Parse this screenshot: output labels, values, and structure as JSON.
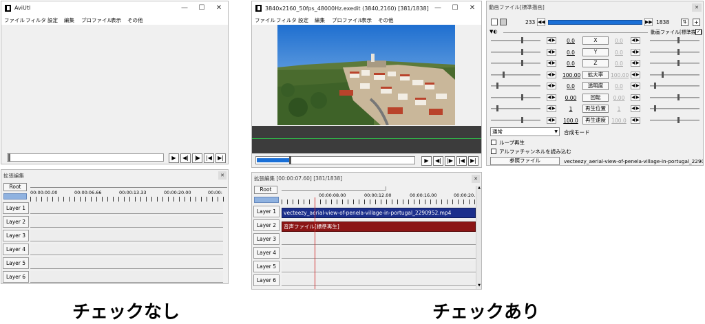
{
  "left_main": {
    "title": "AviUtl",
    "menu": [
      "ファイル",
      "フィルタ",
      "設定",
      "編集",
      "プロファイル",
      "表示",
      "その他"
    ]
  },
  "left_timeline": {
    "title": "拡張編集",
    "root": "Root",
    "ruler": [
      "00:00:00.00",
      "00:00:06.66",
      "00:00:13.33",
      "00:00:20.00",
      "00:00:"
    ],
    "layers": [
      "Layer 1",
      "Layer 2",
      "Layer 3",
      "Layer 4",
      "Layer 5",
      "Layer 6"
    ]
  },
  "center_main": {
    "title": "3840x2160_50fps_48000Hz.exedit (3840,2160)  [381/1838]  デ",
    "menu": [
      "ファイル",
      "フィルタ",
      "設定",
      "編集",
      "プロファイル",
      "表示",
      "その他"
    ],
    "playback_progress": 0.207
  },
  "center_timeline": {
    "title": "拡張編集 [00:00:07.60] [381/1838]",
    "root": "Root",
    "ruler": [
      "00:00:08.00",
      "00:00:12.00",
      "00:00:16.00",
      "00:00:20."
    ],
    "layers": [
      "Layer 1",
      "Layer 2",
      "Layer 3",
      "Layer 4",
      "Layer 5",
      "Layer 6"
    ],
    "clip_video": "vecteezy_aerial-view-of-penela-village-in-portugal_2290952.mp4",
    "clip_audio": "音声ファイル[標準再生]"
  },
  "props": {
    "title": "動画ファイル[標準描画]",
    "frame_start": "233",
    "frame_end": "1838",
    "header_label": "動画ファイル[標準描画]",
    "params": [
      {
        "label": "X",
        "left": "0.0",
        "right": "0.0"
      },
      {
        "label": "Y",
        "left": "0.0",
        "right": "0.0"
      },
      {
        "label": "Z",
        "left": "0.0",
        "right": "0.0"
      },
      {
        "label": "拡大率",
        "left": "100.00",
        "right": "100.00"
      },
      {
        "label": "透明度",
        "left": "0.0",
        "right": "0.0"
      },
      {
        "label": "回転",
        "left": "0.00",
        "right": "0.00"
      },
      {
        "label": "再生位置",
        "left": "1",
        "right": "1"
      },
      {
        "label": "再生速度",
        "left": "100.0",
        "right": "100.0"
      }
    ],
    "blend_value": "通常",
    "blend_label": "合成モード",
    "check_loop": "ループ再生",
    "check_alpha": "アルファチャンネルを読み込む",
    "ref_button": "参照ファイル",
    "filename": "vecteezy_aerial-view-of-penela-village-in-portugal_22909"
  },
  "captions": {
    "left": "チェックなし",
    "right": "チェックあり"
  },
  "colors": {
    "video_clip": "#1c2f8c",
    "audio_clip": "#8b1515",
    "playhead": "#d23030",
    "accent_blue": "#1a6fd6"
  }
}
